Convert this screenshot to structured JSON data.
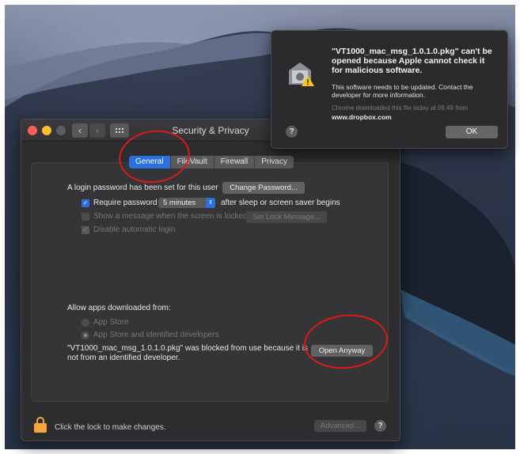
{
  "window": {
    "title": "Security & Privacy",
    "tabs": [
      "General",
      "FileVault",
      "Firewall",
      "Privacy"
    ],
    "active_tab": "General"
  },
  "general": {
    "login_password_text": "A login password has been set for this user",
    "change_password_button": "Change Password...",
    "require_password_label": "Require password",
    "require_password_checked": true,
    "require_password_delay": "5 minutes",
    "after_sleep_text": "after sleep or screen saver begins",
    "show_message_label": "Show a message when the screen is locked",
    "set_lock_message_button": "Set Lock Message...",
    "disable_auto_login_label": "Disable automatic login",
    "allow_apps_heading": "Allow apps downloaded from:",
    "option_app_store": "App Store",
    "option_app_store_identified": "App Store and identified developers",
    "blocked_message_line1": "\"VT1000_mac_msg_1.0.1.0.pkg\" was blocked from use because it is",
    "blocked_message_line2": "not from an identified developer.",
    "open_anyway_button": "Open Anyway"
  },
  "footer": {
    "lock_text": "Click the lock to make changes.",
    "advanced_button": "Advanced...",
    "help_label": "?"
  },
  "dialog": {
    "title": "\"VT1000_mac_msg_1.0.1.0.pkg\" can't be opened because Apple cannot check it for malicious software.",
    "body": "This software needs to be updated. Contact the developer for more information.",
    "source_note": "Chrome downloaded this file today at 09:49 from",
    "source_url": "www.dropbox.com",
    "ok_button": "OK",
    "help_label": "?"
  },
  "colors": {
    "accent": "#2a70e0",
    "annotation": "#e01818",
    "lock": "#f2a73b"
  }
}
